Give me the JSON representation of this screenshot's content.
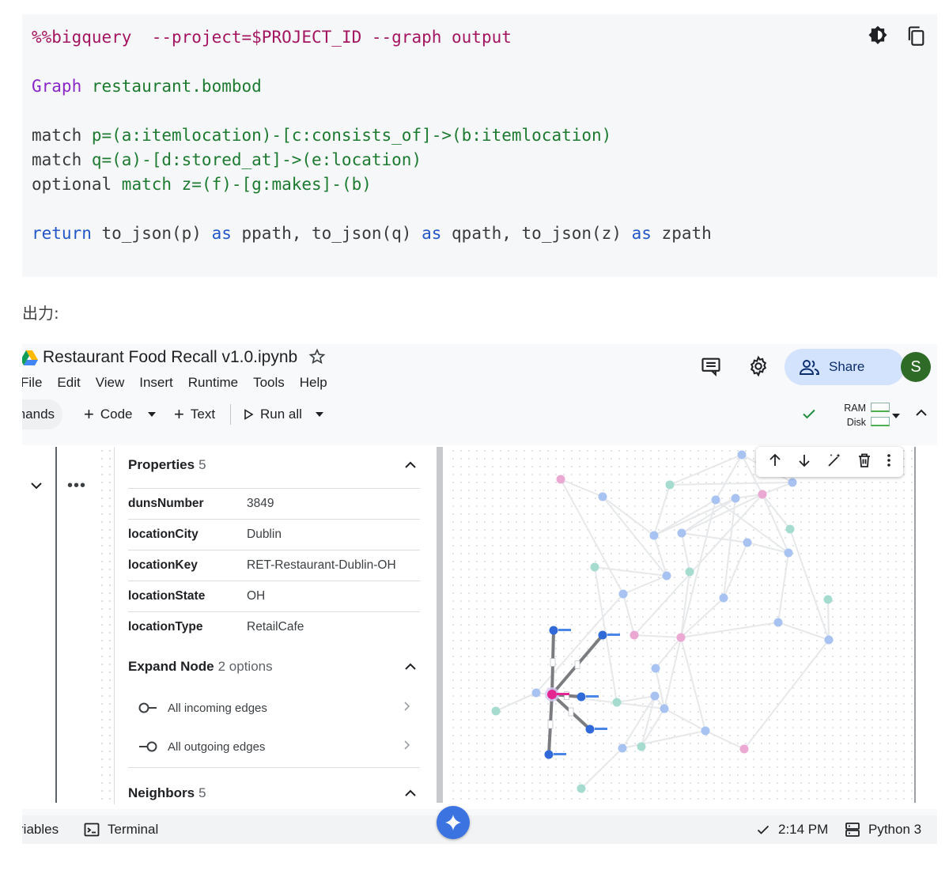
{
  "code": {
    "magic": "%%bigquery",
    "magic_args": "  --project=$PROJECT_ID --graph output",
    "graph_kw": "Graph",
    "graph_name": " restaurant.bombod",
    "line1": {
      "kw": "match ",
      "pattern": "p=(a:itemlocation)-[c:consists_of]->(b:itemlocation)"
    },
    "line2": {
      "kw": "match ",
      "pattern": "q=(a)-[d:stored_at]->(e:location)"
    },
    "line3": {
      "kw": "optional ",
      "kw2": "match",
      "pattern": " z=(f)-[g:makes]-(b)"
    },
    "line4": {
      "kw_return": "return",
      "p1": " to_json(p) ",
      "as1": "as",
      "p2": " ppath, to_json(q) ",
      "as2": "as",
      "p3": " qpath, to_json(z) ",
      "as3": "as",
      "p4": " zpath"
    },
    "icons": [
      "brightness-icon",
      "copy-icon"
    ]
  },
  "output_label": "出力:",
  "colab": {
    "title": "Restaurant Food Recall v1.0.ipynb",
    "menu": [
      "File",
      "Edit",
      "View",
      "Insert",
      "Runtime",
      "Tools",
      "Help"
    ],
    "share_label": "Share",
    "avatar_letter": "S",
    "toolbar": {
      "commands": "mands",
      "code": "Code",
      "text": "Text",
      "run_all": "Run all"
    },
    "resources": {
      "ram": "RAM",
      "disk": "Disk"
    },
    "properties": {
      "title": "Properties",
      "count": "5",
      "rows": [
        {
          "key": "dunsNumber",
          "value": "3849"
        },
        {
          "key": "locationCity",
          "value": "Dublin"
        },
        {
          "key": "locationKey",
          "value": "RET-Restaurant-Dublin-OH"
        },
        {
          "key": "locationState",
          "value": "OH"
        },
        {
          "key": "locationType",
          "value": "RetailCafe"
        }
      ]
    },
    "expand_node": {
      "title": "Expand Node",
      "count": "2 options",
      "options": [
        "All incoming edges",
        "All outgoing edges"
      ]
    },
    "neighbors": {
      "title": "Neighbors",
      "count": "5"
    },
    "statusbar": {
      "variables": "riables",
      "terminal": "Terminal",
      "time": "2:14 PM",
      "runtime": "Python 3"
    },
    "colors": {
      "node_blue": "#a8c2f2",
      "node_teal": "#a6dcd0",
      "node_pink": "#eaa8d3",
      "node_selected": "#e52592",
      "node_dark_blue": "#2f6ad8",
      "accent": "#1a73e8"
    }
  }
}
